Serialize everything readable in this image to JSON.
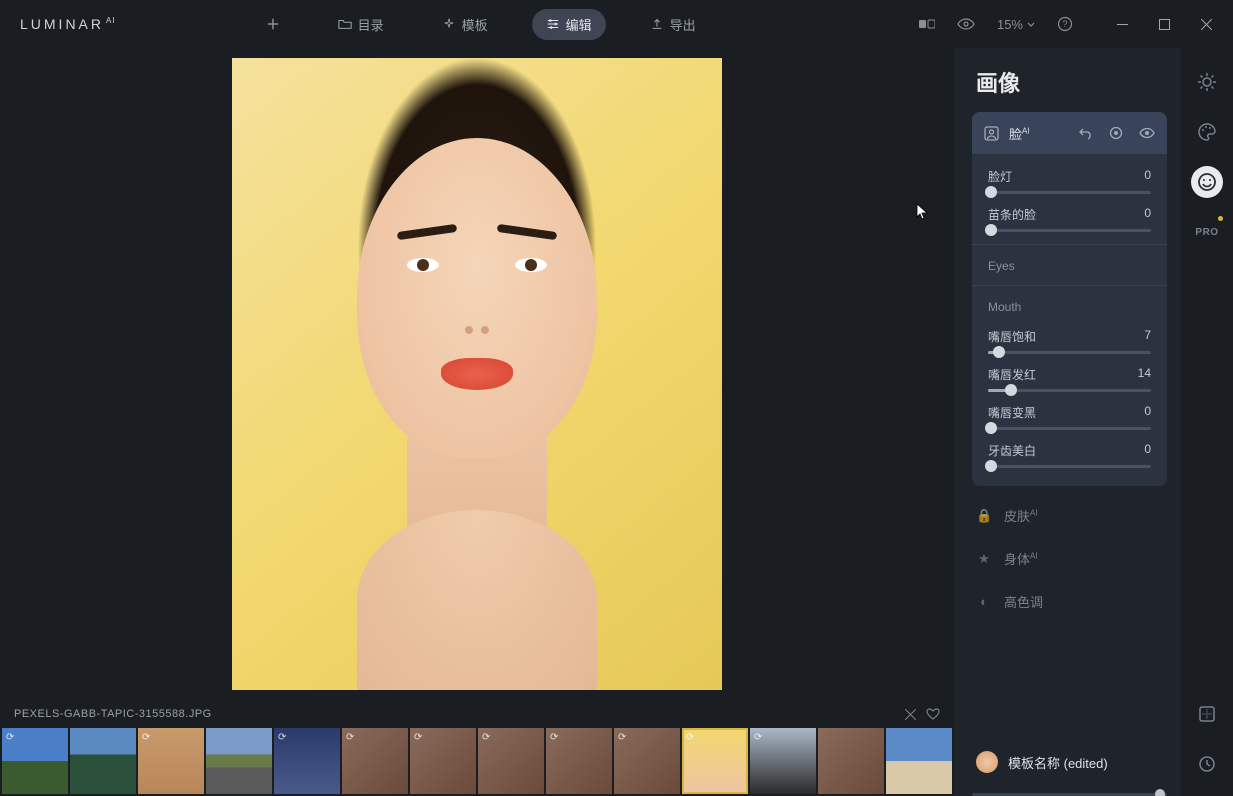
{
  "app": {
    "name": "LUMINAR",
    "suffix": "AI"
  },
  "nav": {
    "catalog": "目录",
    "templates": "模板",
    "edit": "编辑",
    "export": "导出"
  },
  "zoom": "15%",
  "filebar": {
    "filename": "PEXELS-GABB-TAPIC-3155588.JPG"
  },
  "panel": {
    "title": "画像",
    "face": {
      "label": "脸",
      "ai_badge": "AI",
      "sliders": {
        "face_light": {
          "label": "脸灯",
          "value": 0
        },
        "slim_face": {
          "label": "苗条的脸",
          "value": 0
        }
      },
      "eyes_label": "Eyes",
      "mouth_label": "Mouth",
      "mouth": {
        "lips_saturation": {
          "label": "嘴唇饱和",
          "value": 7
        },
        "lips_redness": {
          "label": "嘴唇发红",
          "value": 14
        },
        "lips_darken": {
          "label": "嘴唇变黑",
          "value": 0
        },
        "teeth_whiten": {
          "label": "牙齿美白",
          "value": 0
        }
      }
    },
    "inactive": {
      "skin": "皮肤",
      "body": "身体",
      "high_key": "高色调"
    }
  },
  "template": {
    "name": "模板名称 (edited)"
  },
  "rail": {
    "pro": "PRO"
  }
}
